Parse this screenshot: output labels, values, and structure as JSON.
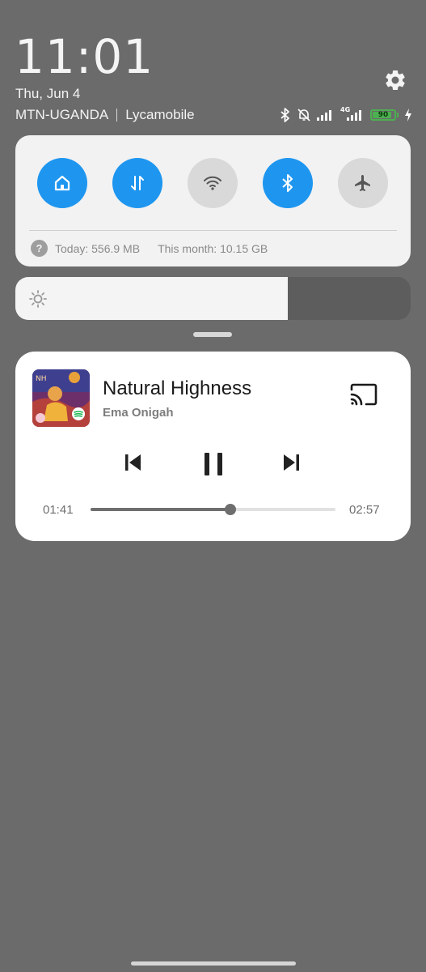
{
  "status": {
    "time": "11:01",
    "date": "Thu, Jun 4",
    "carrier_1": "MTN-UGANDA",
    "carrier_2": "Lycamobile",
    "network_type": "4G",
    "battery_level": "90",
    "battery_fraction": 0.9,
    "battery_color": "#4caf50",
    "icons": [
      "bluetooth-icon",
      "bell-off-icon",
      "signal-icon",
      "signal-4g-icon",
      "battery-icon",
      "charging-icon"
    ]
  },
  "settings_icon": "gear-icon",
  "quick_settings": {
    "accent_color": "#1e96f0",
    "toggles": [
      {
        "name": "home",
        "icon": "home-icon",
        "active": true
      },
      {
        "name": "mobile-data",
        "icon": "data-transfer-icon",
        "active": true
      },
      {
        "name": "wifi",
        "icon": "wifi-icon",
        "active": false
      },
      {
        "name": "bluetooth",
        "icon": "bluetooth-icon",
        "active": true
      },
      {
        "name": "airplane-mode",
        "icon": "airplane-icon",
        "active": false
      }
    ],
    "data_today": "Today: 556.9 MB",
    "data_month": "This month: 10.15 GB"
  },
  "brightness": {
    "level_fraction": 0.69,
    "icon": "brightness-icon"
  },
  "media": {
    "title": "Natural Highness",
    "artist": "Ema Onigah",
    "elapsed": "01:41",
    "duration": "02:57",
    "progress_fraction": 0.57,
    "album_art_icon": "album-art",
    "app_badge_icon": "spotify-icon",
    "cast_icon": "cast-icon",
    "controls": [
      "previous-icon",
      "pause-icon",
      "next-icon"
    ]
  }
}
